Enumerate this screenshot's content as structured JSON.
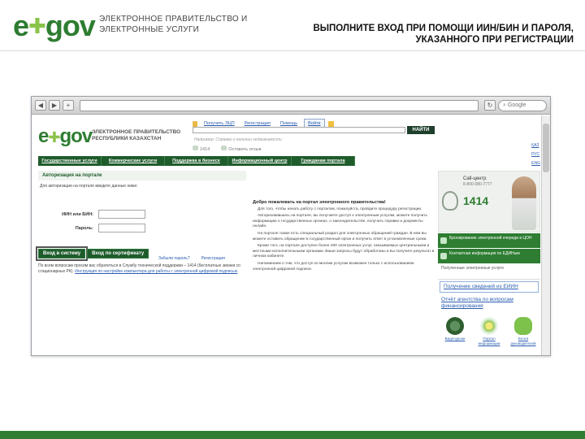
{
  "slide": {
    "logo_e": "e",
    "logo_gov": "gov",
    "org_title": "ЭЛЕКТРОННОЕ ПРАВИТЕЛЬСТВО И ЭЛЕКТРОННЫЕ УСЛУГИ",
    "instruction": "ВЫПОЛНИТЕ ВХОД ПРИ ПОМОЩИ ИИН/БИН И ПАРОЛЯ, УКАЗАННОГО ПРИ РЕГИСТРАЦИИ"
  },
  "browser": {
    "search_placeholder": "Google"
  },
  "portal": {
    "logo_e": "e",
    "logo_gov": "gov",
    "org_name": "ЭЛЕКТРОННОЕ ПРАВИТЕЛЬСТВО РЕСПУБЛИКИ КАЗАХСТАН",
    "top_links": [
      "Получить ЭЦП",
      "Регистрация",
      "Помощь",
      "Войти"
    ],
    "search_button": "НАЙТИ",
    "search_example": "Например: Справка о наличии недвижимости",
    "contacts": [
      "1414",
      "Оставить отзыв"
    ],
    "nav": [
      "Государственные услуги",
      "Коммерческие услуги",
      "Поддержка в бизнесе",
      "Информационный центр",
      "Гражданам портала"
    ],
    "languages": [
      "ҚАЗ",
      "РУС",
      "ENG"
    ]
  },
  "auth": {
    "header": "Авторизация на портале",
    "intro": "Для авторизации на портале введите данные ниже:",
    "login_label": "ИИН или БИН:",
    "password_label": "Пароль:",
    "login_btn": "Вход в систему",
    "cert_btn": "Вход по сертификату",
    "forgot_link": "Забыли пароль?",
    "register_link": "Регистрация",
    "help_text": "По всем вопросам просим вас обратиться в Службу технической поддержки – 1414 (бесплатные звонки со стационарных РК).",
    "help_link": "Инструкция по настройке компьютера для работы с электронной цифровой подписью"
  },
  "welcome": {
    "title": "Добро пожаловать на портал электронного правительства!",
    "paragraphs": [
      "Для того, чтобы начать работу с порталом, пожалуйста, пройдите процедуру регистрации.",
      "Авторизовавшись на портале, вы получаете доступ к электронным услугам, можете получить информацию о государственных органах, о законодательстве, получать справки и документы онлайн.",
      "На портале также есть специальный раздел для электронных обращений граждан. В нем вы можете оставить обращение в государственный орган и получить ответ в установленные сроки.",
      "Кроме того, на портале доступно более 200 электронных услуг, оказываемых центральными и местными исполнительными органами. Ваши запросы будут обработаны и вы получите результат в личном кабинете.",
      "Напоминаем о том, что доступ ко многим услугам возможен только с использованием электронной цифровой подписи."
    ]
  },
  "side": {
    "callcenter_label": "Call-центр",
    "callcenter_phone": "8-800-080-7777",
    "callcenter_number": "1414",
    "banners": [
      "Бронирование электронной очереди в ЦОН",
      "Контактная информация по ЕДИНым"
    ],
    "small_text": "Полученные электронные услуги",
    "links": [
      "Получение сведений из ЕИИН",
      "Отчёт агентства по вопросам финансирования"
    ],
    "media": [
      "Видеоуроки",
      "Портал информации",
      "Блоги руководителей"
    ]
  }
}
